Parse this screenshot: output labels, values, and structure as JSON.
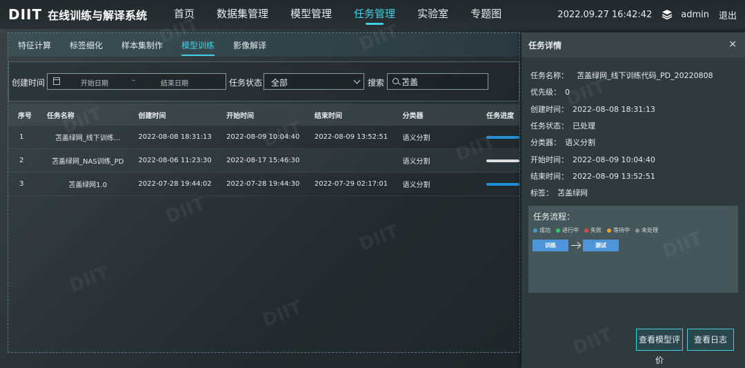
{
  "app": {
    "logo": "DIIT",
    "title": "在线训练与解译系统"
  },
  "nav": {
    "items": [
      {
        "label": "首页"
      },
      {
        "label": "数据集管理"
      },
      {
        "label": "模型管理"
      },
      {
        "label": "任务管理",
        "active": true
      },
      {
        "label": "实验室"
      },
      {
        "label": "专题图"
      }
    ]
  },
  "header": {
    "datetime": "2022.09.27 16:42:42",
    "user": "admin",
    "logout": "退出"
  },
  "subtabs": [
    {
      "label": "特征计算"
    },
    {
      "label": "标签细化"
    },
    {
      "label": "样本集制作"
    },
    {
      "label": "模型训练",
      "active": true
    },
    {
      "label": "影像解译"
    }
  ],
  "filters": {
    "created_label": "创建时间",
    "start_placeholder": "开始日期",
    "range_sep": "–",
    "end_placeholder": "结束日期",
    "status_label": "任务状态",
    "status_value": "全部",
    "search_label": "搜索",
    "search_value": "苫盖"
  },
  "table": {
    "headers": [
      "序号",
      "任务名称",
      "创建时间",
      "开始时间",
      "结束时间",
      "分类器",
      "任务进度"
    ],
    "rows": [
      {
        "idx": "1",
        "name": "苫盖绿网_线下训练...",
        "created": "2022-08-08 18:31:13",
        "start": "2022-08-09 10:04:40",
        "end": "2022-08-09 13:52:51",
        "cls": "语义分割",
        "progress": 1.0
      },
      {
        "idx": "2",
        "name": "苫盖绿网_NAS训练_PD",
        "created": "2022-08-06 11:23:30",
        "start": "2022-08-17 15:46:30",
        "end": "",
        "cls": "语义分割",
        "progress": 1.0
      },
      {
        "idx": "3",
        "name": "苫盖绿网1.0",
        "created": "2022-07-28 19:44:02",
        "start": "2022-07-28 19:44:30",
        "end": "2022-07-29 02:17:01",
        "cls": "语义分割",
        "progress": 1.0
      }
    ]
  },
  "detail": {
    "title": "任务详情",
    "close": "×",
    "fields": [
      {
        "k": "任务名称：",
        "v": "苫盖绿网_线下训练代码_PD_20220808"
      },
      {
        "k": "优先级：",
        "v": "0"
      },
      {
        "k": "创建时间：",
        "v": "2022–08–08 18:31:13"
      },
      {
        "k": "任务状态：",
        "v": "已处理"
      },
      {
        "k": "分类器：",
        "v": "语义分割"
      },
      {
        "k": "开始时间：",
        "v": "2022–08–09 10:04:40"
      },
      {
        "k": "结束时间：",
        "v": "2022–08–09 13:52:51"
      },
      {
        "k": "标签：",
        "v": "苫盖绿网"
      }
    ],
    "flow": {
      "title": "任务流程：",
      "legend": [
        {
          "label": "成功",
          "color": "#4d94d8"
        },
        {
          "label": "进行中",
          "color": "#2ecc71"
        },
        {
          "label": "失败",
          "color": "#e04848"
        },
        {
          "label": "等待中",
          "color": "#f0a030"
        },
        {
          "label": "未处理",
          "color": "#8a9497"
        }
      ],
      "steps": [
        "训练",
        "测试"
      ]
    },
    "buttons": {
      "eval": "查看模型评价",
      "log": "查看日志"
    }
  },
  "colors": {
    "accent": "#3fd2e6",
    "progress": "#1f8fd8"
  }
}
